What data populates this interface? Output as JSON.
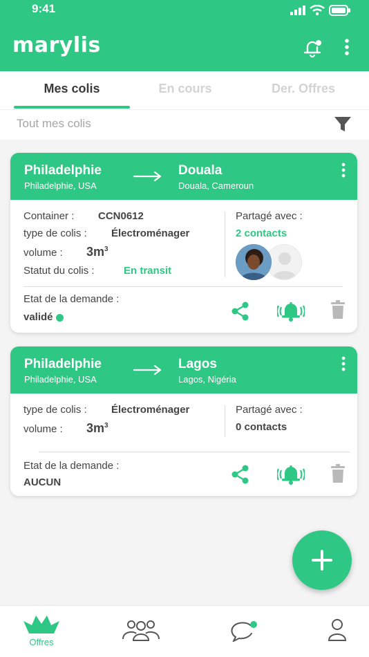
{
  "status_bar": {
    "time": "9:41"
  },
  "app": {
    "logo": "marylis"
  },
  "tabs": [
    {
      "label": "Mes colis"
    },
    {
      "label": "En cours"
    },
    {
      "label": "Der. Offres"
    }
  ],
  "filter": {
    "label": "Tout mes colis"
  },
  "cards": [
    {
      "from_city": "Philadelphie",
      "from_sub": "Philadelphie, USA",
      "to_city": "Douala",
      "to_sub": "Douala, Cameroun",
      "container_label": "Container :",
      "container_value": "CCN0612",
      "type_label": "type de colis :",
      "type_value": "Électroménager",
      "volume_label": "volume :",
      "volume_value": "3m",
      "volume_exp": "3",
      "status_label": "Statut du colis :",
      "status_value": "En transit",
      "shared_label": "Partagé avec :",
      "shared_value": "2 contacts",
      "request_label": "Etat de la demande :",
      "request_value": "validé"
    },
    {
      "from_city": "Philadelphie",
      "from_sub": "Philadelphie, USA",
      "to_city": "Lagos",
      "to_sub": "Lagos, Nigéria",
      "type_label": "type de colis :",
      "type_value": "Électroménager",
      "volume_label": "volume :",
      "volume_value": "3m",
      "volume_exp": "3",
      "shared_label": "Partagé avec :",
      "shared_value": "0 contacts",
      "request_label": "Etat de la demande :",
      "request_value": "AUCUN"
    }
  ],
  "bottom_nav": [
    {
      "label": "Offres",
      "icon": "boat-icon"
    },
    {
      "label": "",
      "icon": "group-icon"
    },
    {
      "label": "",
      "icon": "chat-icon"
    },
    {
      "label": "",
      "icon": "profile-icon"
    }
  ],
  "colors": {
    "primary": "#2fc784",
    "text": "#3a3a3a",
    "muted": "#a5a5a5"
  }
}
